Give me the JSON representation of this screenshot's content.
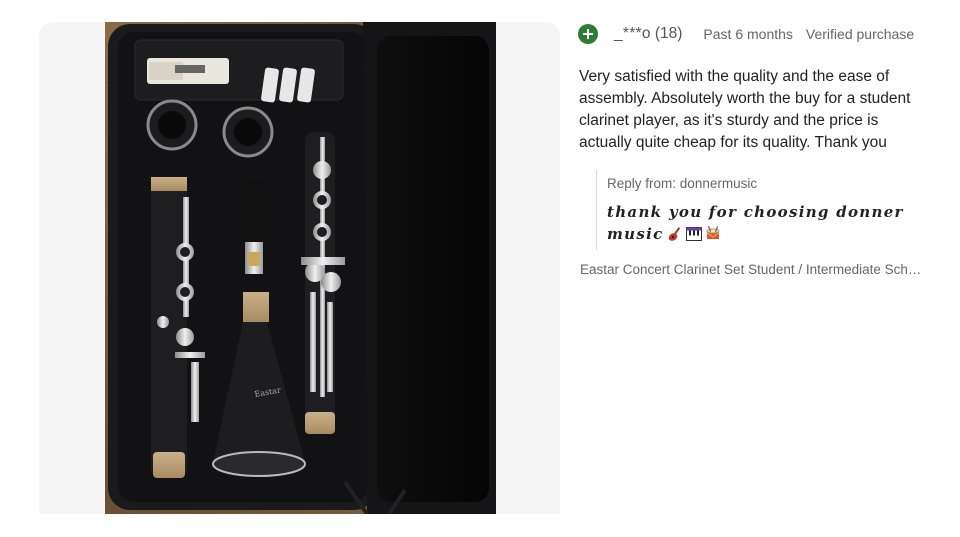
{
  "review": {
    "reviewer_name": "_***o",
    "reviewer_count": "(18)",
    "date": "Past 6 months",
    "verified": "Verified purchase",
    "text": "Very satisfied with the quality and the ease of assembly. Absolutely worth the buy for a student clarinet player, as it's sturdy and the price is actually quite cheap for its quality. Thank you"
  },
  "reply": {
    "label": "Reply from:",
    "author": "donnermusic",
    "text": "thank you for choosing donner music",
    "emojis": [
      "guitar-emoji",
      "piano-keys-emoji",
      "drum-emoji"
    ]
  },
  "product": {
    "title": "Eastar Concert Clarinet Set Student / Intermediate Scho…"
  },
  "photo": {
    "subject": "clarinet-in-case-photo"
  },
  "colors": {
    "plus_icon": "#2e7d32",
    "panel_bg": "#f5f5f5",
    "text_primary": "#222222",
    "text_secondary": "#666666"
  }
}
